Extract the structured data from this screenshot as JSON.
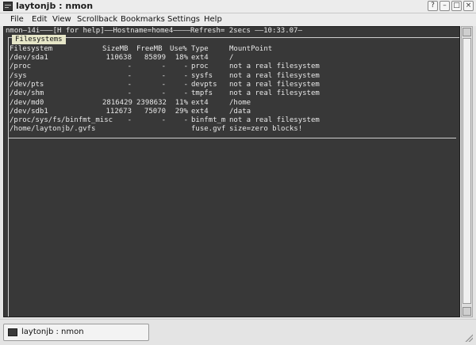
{
  "window": {
    "title": "laytonjb : nmon",
    "buttons": {
      "help": "?",
      "minimize": "–",
      "maximize": "□",
      "close": "×"
    }
  },
  "menubar": {
    "items": [
      "File",
      "Edit",
      "View",
      "Scrollback",
      "Bookmarks",
      "Settings",
      "Help"
    ]
  },
  "terminal": {
    "header_line": "nmon—14i———[H for help]——Hostname=home4————Refresh= 2secs ——10:33.07—",
    "section_tab": "Filesystems",
    "columns": {
      "filesystem": "Filesystem",
      "size": "SizeMB",
      "free": "FreeMB",
      "use": "Use%",
      "type": "Type",
      "mount": "MountPoint"
    },
    "rows": [
      {
        "fs": "/dev/sda1",
        "size": "110638",
        "free": "85899",
        "use": "18%",
        "type": "ext4",
        "mount": "/"
      },
      {
        "fs": "/proc",
        "size": "-",
        "free": "-",
        "use": "-",
        "type": "proc",
        "mount": "not a real filesystem"
      },
      {
        "fs": "/sys",
        "size": "-",
        "free": "-",
        "use": "-",
        "type": "sysfs",
        "mount": "not a real filesystem"
      },
      {
        "fs": "/dev/pts",
        "size": "-",
        "free": "-",
        "use": "-",
        "type": "devpts",
        "mount": "not a real filesystem"
      },
      {
        "fs": "/dev/shm",
        "size": "-",
        "free": "-",
        "use": "-",
        "type": "tmpfs",
        "mount": "not a real filesystem"
      },
      {
        "fs": "/dev/md0",
        "size": "2816429",
        "free": "2398632",
        "use": "11%",
        "type": "ext4",
        "mount": "/home"
      },
      {
        "fs": "/dev/sdb1",
        "size": "112673",
        "free": "75070",
        "use": "29%",
        "type": "ext4",
        "mount": "/data"
      },
      {
        "fs": "/proc/sys/fs/binfmt_misc",
        "size": "-",
        "free": "-",
        "use": "-",
        "type": "binfmt_m",
        "mount": "not a real filesystem"
      },
      {
        "fs": "/home/laytonjb/.gvfs",
        "size": "",
        "free": "",
        "use": "",
        "type": "fuse.gvf",
        "mount": "size=zero blocks!"
      }
    ]
  },
  "taskbar": {
    "task_label": "laytonjb : nmon"
  },
  "colors": {
    "terminal_bg": "#383838",
    "terminal_fg": "#e8e8e8",
    "tab_bg": "#e6e6c8"
  }
}
